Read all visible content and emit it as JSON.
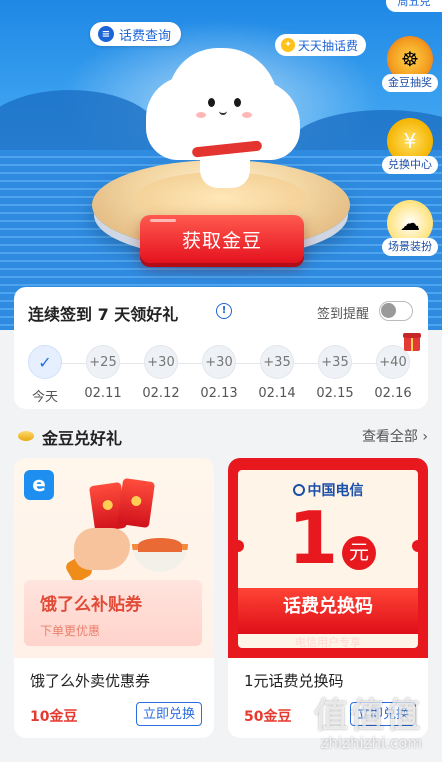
{
  "hero": {
    "top_tab": "周五兑",
    "query_label": "话费查询",
    "draw_label": "天天抽话费",
    "main_button": "获取金豆",
    "side_entries": [
      {
        "label": "金豆抽奖",
        "icon": "prize-wheel-icon"
      },
      {
        "label": "兑换中心",
        "icon": "yuan-coin-icon"
      },
      {
        "label": "场景装扮",
        "icon": "cloud-mascot-icon"
      }
    ]
  },
  "signin": {
    "title": "连续签到 7 天领好礼",
    "remind_label": "签到提醒",
    "remind_enabled": false,
    "days": [
      {
        "reward": "✓",
        "date": "今天",
        "done": true
      },
      {
        "reward": "+25",
        "date": "02.11",
        "done": false
      },
      {
        "reward": "+30",
        "date": "02.12",
        "done": false
      },
      {
        "reward": "+30",
        "date": "02.13",
        "done": false
      },
      {
        "reward": "+35",
        "date": "02.14",
        "done": false
      },
      {
        "reward": "+35",
        "date": "02.15",
        "done": false
      },
      {
        "reward": "+40",
        "date": "02.16",
        "done": false
      }
    ]
  },
  "section": {
    "title": "金豆兑好礼",
    "view_all": "查看全部 ›"
  },
  "products": [
    {
      "name": "饿了么外卖优惠券",
      "price": "10金豆",
      "button": "立即兑换",
      "art_title": "饿了么补贴券",
      "art_subtitle": "下单更优惠"
    },
    {
      "name": "1元话费兑换码",
      "price": "50金豆",
      "button": "立即兑换",
      "art_brand": "中国电信",
      "art_amount": "1",
      "art_unit": "元",
      "art_title": "话费兑换码",
      "art_subtitle": "电信用户专享"
    }
  ],
  "watermark": {
    "big": "值值值",
    "url": "zhizhizhi.com"
  },
  "colors": {
    "brand_blue": "#1d64d6",
    "accent_red": "#e53a2f",
    "telecom_red": "#e8191e"
  }
}
